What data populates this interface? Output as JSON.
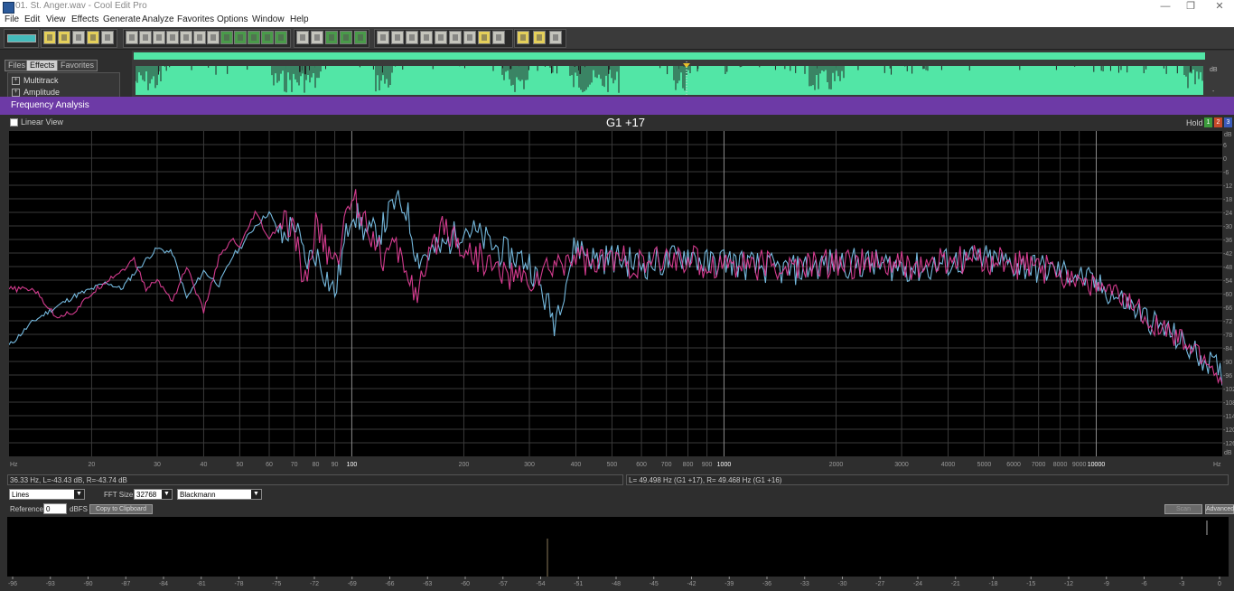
{
  "window": {
    "title": "01. St. Anger.wav - Cool Edit Pro",
    "minimize_icon": "—",
    "restore_icon": "❐",
    "close_icon": "✕"
  },
  "menu": [
    "File",
    "Edit",
    "View",
    "Effects",
    "Generate",
    "Analyze",
    "Favorites",
    "Options",
    "Window",
    "Help"
  ],
  "panel": {
    "tabs": [
      "Files",
      "Effects",
      "Favorites"
    ],
    "active_tab": "Effects",
    "tree": [
      "Multitrack",
      "Amplitude"
    ]
  },
  "overview": {
    "db_label": "dB",
    "db_tick": "-",
    "wave_color": "#52e6a6"
  },
  "analysis": {
    "panel_title": "Frequency Analysis",
    "linear_view_label": "Linear View",
    "note_readout": "G1 +17",
    "hold_label": "Hold",
    "hold_buttons": [
      "1",
      "2",
      "3"
    ],
    "x_axis_label_left": "Hz",
    "x_axis_label_right": "Hz",
    "db_axis_label": "dB",
    "x_ticks": [
      "20",
      "30",
      "40",
      "50",
      "60",
      "70",
      "80",
      "90",
      "100",
      "200",
      "300",
      "400",
      "500",
      "600",
      "700",
      "800",
      "900",
      "1000",
      "2000",
      "3000",
      "4000",
      "5000",
      "6000",
      "7000",
      "8000",
      "9000",
      "10000"
    ],
    "x_tick_values": [
      20,
      30,
      40,
      50,
      60,
      70,
      80,
      90,
      100,
      200,
      300,
      400,
      500,
      600,
      700,
      800,
      900,
      1000,
      2000,
      3000,
      4000,
      5000,
      6000,
      7000,
      8000,
      9000,
      10000
    ],
    "y_ticks": [
      "6",
      "0",
      "-6",
      "-12",
      "-18",
      "-24",
      "-30",
      "-36",
      "-42",
      "-48",
      "-54",
      "-60",
      "-66",
      "-72",
      "-78",
      "-84",
      "-90",
      "-96",
      "-102",
      "-108",
      "-114",
      "-120",
      "-126"
    ],
    "y_tick_top": "dB",
    "y_tick_bottom": "dB",
    "cursor_status": "36.33 Hz, L=-43.43 dB, R=-43.74 dB",
    "peak_status": "L= 49.498 Hz (G1 +17), R= 49.468 Hz (G1 +16)"
  },
  "chart_data": {
    "type": "line",
    "x_scale": "log",
    "x_unit": "Hz",
    "y_unit": "dB",
    "xlim": [
      12,
      22050
    ],
    "ylim": [
      -132,
      12
    ],
    "grid": true,
    "series": [
      {
        "color": "#7ec8f0",
        "x": [
          12,
          14,
          16,
          18,
          20,
          22,
          24,
          26,
          28,
          30,
          33,
          36,
          40,
          44,
          48,
          50,
          55,
          60,
          65,
          70,
          75,
          80,
          90,
          100,
          110,
          120,
          130,
          140,
          150,
          175,
          200,
          250,
          300,
          350,
          400,
          450,
          500,
          600,
          700,
          800,
          900,
          1000,
          1200,
          1500,
          2000,
          2500,
          3000,
          3500,
          4000,
          5000,
          6000,
          7000,
          8000,
          9000,
          10000,
          12000,
          14000,
          16000,
          18000,
          20000,
          22050
        ],
        "y": [
          -83,
          -72,
          -66,
          -61,
          -58,
          -55,
          -58,
          -51,
          -45,
          -40,
          -42,
          -62,
          -50,
          -56,
          -43,
          -40,
          -30,
          -24,
          -36,
          -28,
          -46,
          -42,
          -60,
          -22,
          -34,
          -32,
          -20,
          -22,
          -44,
          -40,
          -30,
          -41,
          -46,
          -72,
          -38,
          -45,
          -44,
          -47,
          -46,
          -42,
          -47,
          -45,
          -48,
          -50,
          -46,
          -47,
          -48,
          -49,
          -46,
          -45,
          -47,
          -49,
          -50,
          -52,
          -56,
          -64,
          -72,
          -78,
          -85,
          -90,
          -96
        ]
      },
      {
        "color": "#e5409a",
        "x": [
          12,
          14,
          16,
          18,
          20,
          22,
          24,
          26,
          28,
          30,
          33,
          36,
          40,
          44,
          48,
          50,
          55,
          60,
          65,
          70,
          75,
          80,
          90,
          100,
          110,
          120,
          130,
          140,
          150,
          175,
          200,
          250,
          300,
          350,
          400,
          450,
          500,
          600,
          700,
          800,
          900,
          1000,
          1200,
          1500,
          2000,
          2500,
          3000,
          3500,
          4000,
          5000,
          6000,
          7000,
          8000,
          9000,
          10000,
          12000,
          14000,
          16000,
          18000,
          20000,
          22050
        ],
        "y": [
          -58,
          -58,
          -70,
          -68,
          -60,
          -54,
          -50,
          -45,
          -58,
          -54,
          -63,
          -48,
          -68,
          -44,
          -36,
          -40,
          -24,
          -36,
          -28,
          -34,
          -56,
          -30,
          -48,
          -16,
          -28,
          -44,
          -40,
          -48,
          -62,
          -28,
          -40,
          -50,
          -55,
          -48,
          -42,
          -48,
          -44,
          -48,
          -45,
          -44,
          -48,
          -46,
          -47,
          -49,
          -46,
          -47,
          -48,
          -48,
          -46,
          -45,
          -47,
          -49,
          -51,
          -53,
          -57,
          -63,
          -71,
          -79,
          -84,
          -90,
          -102
        ]
      }
    ]
  },
  "controls": {
    "mode_value": "Lines",
    "fft_size_label": "FFT Size",
    "fft_size_value": "32768",
    "window_value": "Blackmann",
    "reference_label": "Reference",
    "reference_value": "0",
    "dbfs_label": "dBFS",
    "copy_button": "Copy to Clipboard",
    "scan_button": "Scan",
    "advanced_button": "Advanced",
    "dropdown_arrow": "▼"
  },
  "meter": {
    "ticks": [
      "-96",
      "-93",
      "-90",
      "-87",
      "-84",
      "-81",
      "-78",
      "-75",
      "-72",
      "-69",
      "-66",
      "-63",
      "-60",
      "-57",
      "-54",
      "-51",
      "-48",
      "-45",
      "-42",
      "-39",
      "-36",
      "-33",
      "-30",
      "-27",
      "-24",
      "-21",
      "-18",
      "-15",
      "-12",
      "-9",
      "-6",
      "-3",
      "0"
    ]
  }
}
